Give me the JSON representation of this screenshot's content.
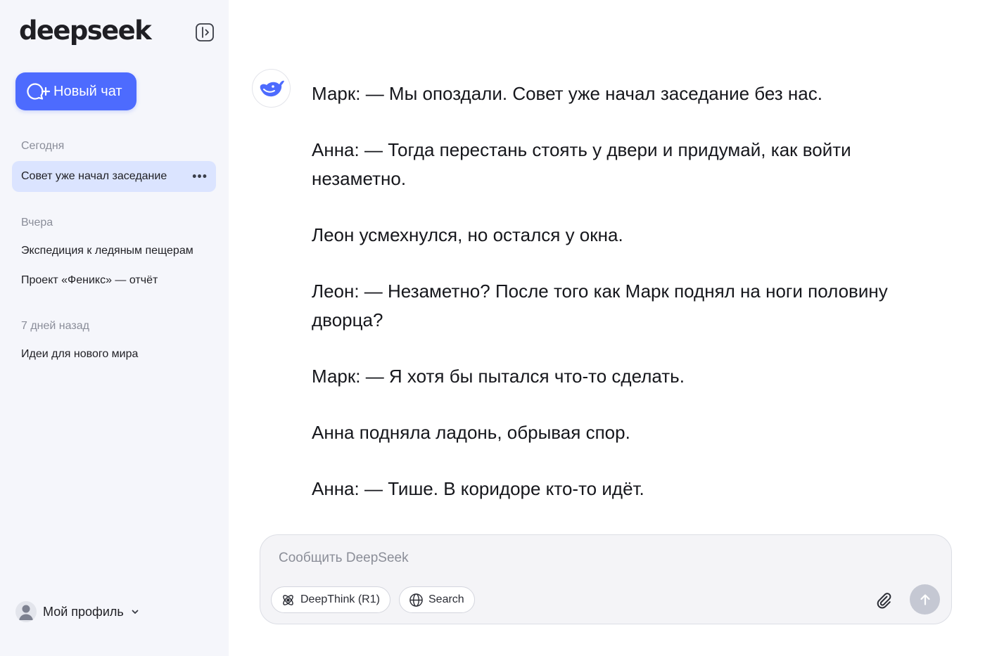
{
  "app": {
    "logo": "deepseek",
    "brand_color": "#4d6bfe"
  },
  "sidebar": {
    "new_chat_label": "Новый чат",
    "sections": [
      {
        "label": "Сегодня",
        "items": [
          {
            "label": "Совет уже начал заседание",
            "active": true
          }
        ]
      },
      {
        "label": "Вчера",
        "items": [
          {
            "label": "Экспедиция к ледяным пещерам"
          },
          {
            "label": "Проект «Феникс» — отчёт"
          }
        ]
      },
      {
        "label": "7 дней назад",
        "items": [
          {
            "label": "Идеи для нового мира"
          }
        ]
      }
    ],
    "more_icon": "ellipsis-icon",
    "profile_label": "Мой профиль"
  },
  "chat": {
    "assistant_icon": "deepseek-whale-icon",
    "paragraphs": [
      "Марк: — Мы опоздали. Совет уже начал заседание без нас.",
      "Анна: — Тогда перестань стоять у двери и придумай, как войти незаметно.",
      "Леон усмехнулся, но остался у окна.",
      "Леон: — Незаметно? После того как Марк поднял на ноги половину дворца?",
      "Марк: — Я хотя бы пытался что-то сделать.",
      "Анна подняла ладонь, обрывая спор.",
      "Анна: — Тише. В коридоре кто-то идёт."
    ]
  },
  "composer": {
    "placeholder": "Сообщить DeepSeek",
    "value": "",
    "deepthink_label": "DeepThink (R1)",
    "search_label": "Search"
  }
}
